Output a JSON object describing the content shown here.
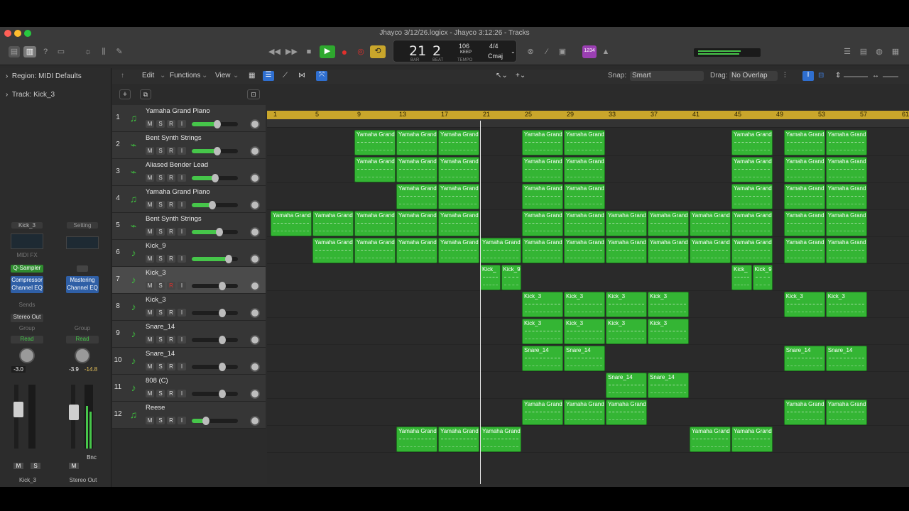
{
  "window": {
    "title": "Jhayco 3/12/26.logicx - Jhayco 3:12:26 - Tracks",
    "traffic_colors": [
      "#ff5f57",
      "#febc2e",
      "#28c840"
    ]
  },
  "lcd": {
    "bar": "21",
    "beat": "2",
    "bar_caption": "BAR",
    "beat_caption": "BEAT",
    "tempo": "106",
    "tempo_mode": "KEEP",
    "tempo_caption": "TEMPO",
    "signature": "4/4",
    "key": "Cmaj"
  },
  "count_in": "1234",
  "menus": {
    "edit": "Edit",
    "functions": "Functions",
    "view": "View",
    "snap_label": "Snap:",
    "snap_value": "Smart",
    "drag_label": "Drag:",
    "drag_value": "No Overlap"
  },
  "inspector": {
    "region": "Region: MIDI Defaults",
    "track": "Track: Kick_3",
    "strip1": {
      "name": "Kick_3",
      "midi_fx": "MIDI FX",
      "instrument": "Q-Sampler",
      "fx": "Compressor\nChannel EQ",
      "sends": "Sends",
      "output": "Stereo Out",
      "group": "Group",
      "automation": "Read",
      "volume": "-3.0",
      "mute": "M",
      "solo": "S",
      "footer": "Kick_3"
    },
    "strip2": {
      "name": "Setting",
      "fx": "Mastering\nChannel EQ",
      "group": "Group",
      "automation": "Read",
      "volume": "-3.9",
      "peak": "-14.8",
      "mute": "M",
      "bounce": "Bnc",
      "footer": "Stereo Out"
    }
  },
  "ruler": [
    "1",
    "5",
    "9",
    "13",
    "17",
    "21",
    "25",
    "29",
    "33",
    "37",
    "41",
    "45",
    "49",
    "53",
    "57",
    "61"
  ],
  "tracks": [
    {
      "num": "1",
      "name": "Yamaha Grand Piano",
      "icon": "piano",
      "vol": 0.55,
      "rec": true
    },
    {
      "num": "2",
      "name": "Bent Synth Strings",
      "icon": "synth",
      "vol": 0.55,
      "rec": true
    },
    {
      "num": "3",
      "name": "Aliased Bender Lead",
      "icon": "synth",
      "vol": 0.5,
      "rec": true
    },
    {
      "num": "4",
      "name": "Yamaha Grand Piano",
      "icon": "piano",
      "vol": 0.45,
      "rec": true
    },
    {
      "num": "5",
      "name": "Bent Synth Strings",
      "icon": "synth",
      "vol": 0.6,
      "rec": true
    },
    {
      "num": "6",
      "name": "Kick_9",
      "icon": "drum",
      "vol": 0.8,
      "rec": true
    },
    {
      "num": "7",
      "name": "Kick_3",
      "icon": "drum",
      "vol": 0.0,
      "rec": false
    },
    {
      "num": "8",
      "name": "Kick_3",
      "icon": "drum",
      "vol": 0.0,
      "rec": true
    },
    {
      "num": "9",
      "name": "Snare_14",
      "icon": "drum",
      "vol": 0.0,
      "rec": true
    },
    {
      "num": "10",
      "name": "Snare_14",
      "icon": "drum",
      "vol": 0.0,
      "rec": true
    },
    {
      "num": "11",
      "name": "808 (C)",
      "icon": "drum",
      "vol": 0.0,
      "rec": true
    },
    {
      "num": "12",
      "name": "Reese",
      "icon": "piano",
      "vol": 0.3,
      "rec": true
    }
  ],
  "track_buttons": {
    "mute": "M",
    "solo": "S",
    "record": "R",
    "input": "I"
  },
  "regions": [
    {
      "track": 0,
      "start": 9,
      "len": 4,
      "name": "Yamaha Grand"
    },
    {
      "track": 0,
      "start": 13,
      "len": 4,
      "name": "Yamaha Grand"
    },
    {
      "track": 0,
      "start": 17,
      "len": 4,
      "name": "Yamaha Grand"
    },
    {
      "track": 0,
      "start": 25,
      "len": 4,
      "name": "Yamaha Grand"
    },
    {
      "track": 0,
      "start": 29,
      "len": 4,
      "name": "Yamaha Grand"
    },
    {
      "track": 0,
      "start": 45,
      "len": 4,
      "name": "Yamaha Grand"
    },
    {
      "track": 0,
      "start": 50,
      "len": 4,
      "name": "Yamaha Grand"
    },
    {
      "track": 0,
      "start": 54,
      "len": 4,
      "name": "Yamaha Grand"
    },
    {
      "track": 1,
      "start": 9,
      "len": 4,
      "name": "Yamaha Grand"
    },
    {
      "track": 1,
      "start": 13,
      "len": 4,
      "name": "Yamaha Grand"
    },
    {
      "track": 1,
      "start": 17,
      "len": 4,
      "name": "Yamaha Grand"
    },
    {
      "track": 1,
      "start": 25,
      "len": 4,
      "name": "Yamaha Grand"
    },
    {
      "track": 1,
      "start": 29,
      "len": 4,
      "name": "Yamaha Grand"
    },
    {
      "track": 1,
      "start": 45,
      "len": 4,
      "name": "Yamaha Grand"
    },
    {
      "track": 1,
      "start": 50,
      "len": 4,
      "name": "Yamaha Grand"
    },
    {
      "track": 1,
      "start": 54,
      "len": 4,
      "name": "Yamaha Grand"
    },
    {
      "track": 2,
      "start": 13,
      "len": 4,
      "name": "Yamaha Grand"
    },
    {
      "track": 2,
      "start": 17,
      "len": 4,
      "name": "Yamaha Grand"
    },
    {
      "track": 2,
      "start": 25,
      "len": 4,
      "name": "Yamaha Grand"
    },
    {
      "track": 2,
      "start": 29,
      "len": 4,
      "name": "Yamaha Grand"
    },
    {
      "track": 2,
      "start": 45,
      "len": 4,
      "name": "Yamaha Grand"
    },
    {
      "track": 2,
      "start": 50,
      "len": 4,
      "name": "Yamaha Grand"
    },
    {
      "track": 2,
      "start": 54,
      "len": 4,
      "name": "Yamaha Grand"
    },
    {
      "track": 3,
      "start": 1,
      "len": 4,
      "name": "Yamaha Grand"
    },
    {
      "track": 3,
      "start": 5,
      "len": 4,
      "name": "Yamaha Grand"
    },
    {
      "track": 3,
      "start": 9,
      "len": 4,
      "name": "Yamaha Grand"
    },
    {
      "track": 3,
      "start": 13,
      "len": 4,
      "name": "Yamaha Grand"
    },
    {
      "track": 3,
      "start": 17,
      "len": 4,
      "name": "Yamaha Grand"
    },
    {
      "track": 3,
      "start": 25,
      "len": 4,
      "name": "Yamaha Grand"
    },
    {
      "track": 3,
      "start": 29,
      "len": 4,
      "name": "Yamaha Grand"
    },
    {
      "track": 3,
      "start": 33,
      "len": 4,
      "name": "Yamaha Grand"
    },
    {
      "track": 3,
      "start": 37,
      "len": 4,
      "name": "Yamaha Grand"
    },
    {
      "track": 3,
      "start": 41,
      "len": 4,
      "name": "Yamaha Grand"
    },
    {
      "track": 3,
      "start": 45,
      "len": 4,
      "name": "Yamaha Grand"
    },
    {
      "track": 3,
      "start": 50,
      "len": 4,
      "name": "Yamaha Grand"
    },
    {
      "track": 3,
      "start": 54,
      "len": 4,
      "name": "Yamaha Grand"
    },
    {
      "track": 4,
      "start": 5,
      "len": 4,
      "name": "Yamaha Grand"
    },
    {
      "track": 4,
      "start": 9,
      "len": 4,
      "name": "Yamaha Grand"
    },
    {
      "track": 4,
      "start": 13,
      "len": 4,
      "name": "Yamaha Grand"
    },
    {
      "track": 4,
      "start": 17,
      "len": 4,
      "name": "Yamaha Grand"
    },
    {
      "track": 4,
      "start": 21,
      "len": 4,
      "name": "Yamaha Grand"
    },
    {
      "track": 4,
      "start": 25,
      "len": 4,
      "name": "Yamaha Grand"
    },
    {
      "track": 4,
      "start": 29,
      "len": 4,
      "name": "Yamaha Grand"
    },
    {
      "track": 4,
      "start": 33,
      "len": 4,
      "name": "Yamaha Grand"
    },
    {
      "track": 4,
      "start": 37,
      "len": 4,
      "name": "Yamaha Grand"
    },
    {
      "track": 4,
      "start": 41,
      "len": 4,
      "name": "Yamaha Grand"
    },
    {
      "track": 4,
      "start": 45,
      "len": 4,
      "name": "Yamaha Grand"
    },
    {
      "track": 4,
      "start": 50,
      "len": 4,
      "name": "Yamaha Grand"
    },
    {
      "track": 4,
      "start": 54,
      "len": 4,
      "name": "Yamaha Grand"
    },
    {
      "track": 5,
      "start": 21,
      "len": 2,
      "name": "Kick_"
    },
    {
      "track": 5,
      "start": 23,
      "len": 2,
      "name": "Kick_9"
    },
    {
      "track": 5,
      "start": 45,
      "len": 2,
      "name": "Kick_"
    },
    {
      "track": 5,
      "start": 47,
      "len": 2,
      "name": "Kick_9"
    },
    {
      "track": 6,
      "start": 25,
      "len": 4,
      "name": "Kick_3"
    },
    {
      "track": 6,
      "start": 29,
      "len": 4,
      "name": "Kick_3"
    },
    {
      "track": 6,
      "start": 33,
      "len": 4,
      "name": "Kick_3"
    },
    {
      "track": 6,
      "start": 37,
      "len": 4,
      "name": "Kick_3"
    },
    {
      "track": 6,
      "start": 50,
      "len": 4,
      "name": "Kick_3"
    },
    {
      "track": 6,
      "start": 54,
      "len": 4,
      "name": "Kick_3"
    },
    {
      "track": 7,
      "start": 25,
      "len": 4,
      "name": "Kick_3"
    },
    {
      "track": 7,
      "start": 29,
      "len": 4,
      "name": "Kick_3"
    },
    {
      "track": 7,
      "start": 33,
      "len": 4,
      "name": "Kick_3"
    },
    {
      "track": 7,
      "start": 37,
      "len": 4,
      "name": "Kick_3"
    },
    {
      "track": 8,
      "start": 25,
      "len": 4,
      "name": "Snare_14"
    },
    {
      "track": 8,
      "start": 29,
      "len": 4,
      "name": "Snare_14"
    },
    {
      "track": 8,
      "start": 50,
      "len": 4,
      "name": "Snare_14"
    },
    {
      "track": 8,
      "start": 54,
      "len": 4,
      "name": "Snare_14"
    },
    {
      "track": 9,
      "start": 33,
      "len": 4,
      "name": "Snare_14"
    },
    {
      "track": 9,
      "start": 37,
      "len": 4,
      "name": "Snare_14"
    },
    {
      "track": 10,
      "start": 25,
      "len": 4,
      "name": "Yamaha Grand"
    },
    {
      "track": 10,
      "start": 29,
      "len": 4,
      "name": "Yamaha Grand"
    },
    {
      "track": 10,
      "start": 33,
      "len": 4,
      "name": "Yamaha Grand"
    },
    {
      "track": 10,
      "start": 50,
      "len": 4,
      "name": "Yamaha Grand"
    },
    {
      "track": 10,
      "start": 54,
      "len": 4,
      "name": "Yamaha Grand"
    },
    {
      "track": 11,
      "start": 13,
      "len": 4,
      "name": "Yamaha Grand"
    },
    {
      "track": 11,
      "start": 17,
      "len": 4,
      "name": "Yamaha Grand"
    },
    {
      "track": 11,
      "start": 21,
      "len": 4,
      "name": "Yamaha Grand"
    },
    {
      "track": 11,
      "start": 41,
      "len": 4,
      "name": "Yamaha Grand"
    },
    {
      "track": 11,
      "start": 45,
      "len": 4,
      "name": "Yamaha Grand"
    }
  ],
  "playhead_bar": 21,
  "colors": {
    "region": "#34b534",
    "ruler": "#c9a62b",
    "accent_green": "#46c64a",
    "record": "#e0302c"
  }
}
